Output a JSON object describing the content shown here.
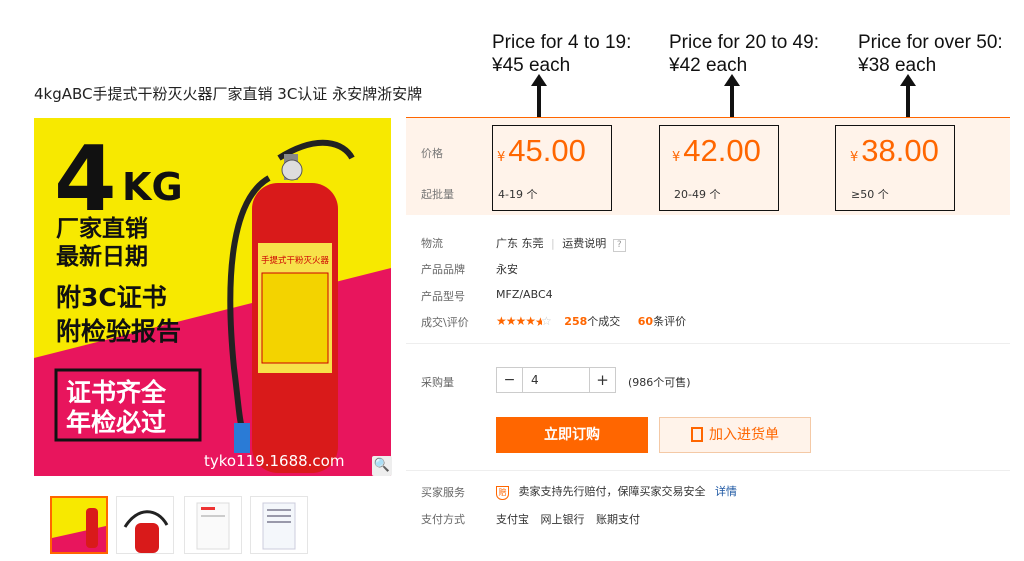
{
  "annotations": [
    {
      "line1": "Price for 4 to 19:",
      "line2": "¥45 each"
    },
    {
      "line1": "Price for 20 to 49:",
      "line2": "¥42 each"
    },
    {
      "line1": "Price for over 50:",
      "line2": "¥38 each"
    }
  ],
  "product": {
    "title": "4kgABC手提式干粉灭火器厂家直销 3C认证 永安牌浙安牌",
    "image": {
      "big_text": "4",
      "kg": "KG",
      "line1": "厂家直销",
      "line2": "最新日期",
      "line3": "附3C证书",
      "line4": "附检验报告",
      "box1": "证书齐全",
      "box2": "年检必过",
      "watermark": "tyko119.1688.com",
      "label_text": "手提式干粉灭火器"
    }
  },
  "price": {
    "label": "价格",
    "moq_label": "起批量",
    "currency": "¥",
    "tiers": [
      {
        "value": "45.00",
        "moq": "4-19 个"
      },
      {
        "value": "42.00",
        "moq": "20-49 个"
      },
      {
        "value": "38.00",
        "moq": "≥50 个"
      }
    ]
  },
  "details": {
    "logistics_label": "物流",
    "logistics_value": "广东 东莞",
    "logistics_link": "运费说明",
    "brand_label": "产品品牌",
    "brand_value": "永安",
    "model_label": "产品型号",
    "model_value": "MFZ/ABC4",
    "deals_label": "成交\\评价",
    "rating": 4.5,
    "deals_count": "258",
    "deals_unit": "个成交",
    "reviews_count": "60",
    "reviews_unit": "条评价"
  },
  "purchase": {
    "qty_label": "采购量",
    "qty_value": "4",
    "minus": "−",
    "plus": "+",
    "stock": "(986个可售)",
    "buy_label": "立即订购",
    "cart_label": "加入进货单"
  },
  "service": {
    "service_label": "买家服务",
    "service_text": "卖家支持先行赔付，保障买家交易安全",
    "service_link": "详情",
    "pay_label": "支付方式",
    "pay_methods": [
      "支付宝",
      "网上银行",
      "账期支付"
    ]
  },
  "colors": {
    "accent": "#ff6600",
    "price_bg": "#fff3ea",
    "image_yellow": "#f7e900",
    "image_pink": "#e8155d"
  }
}
